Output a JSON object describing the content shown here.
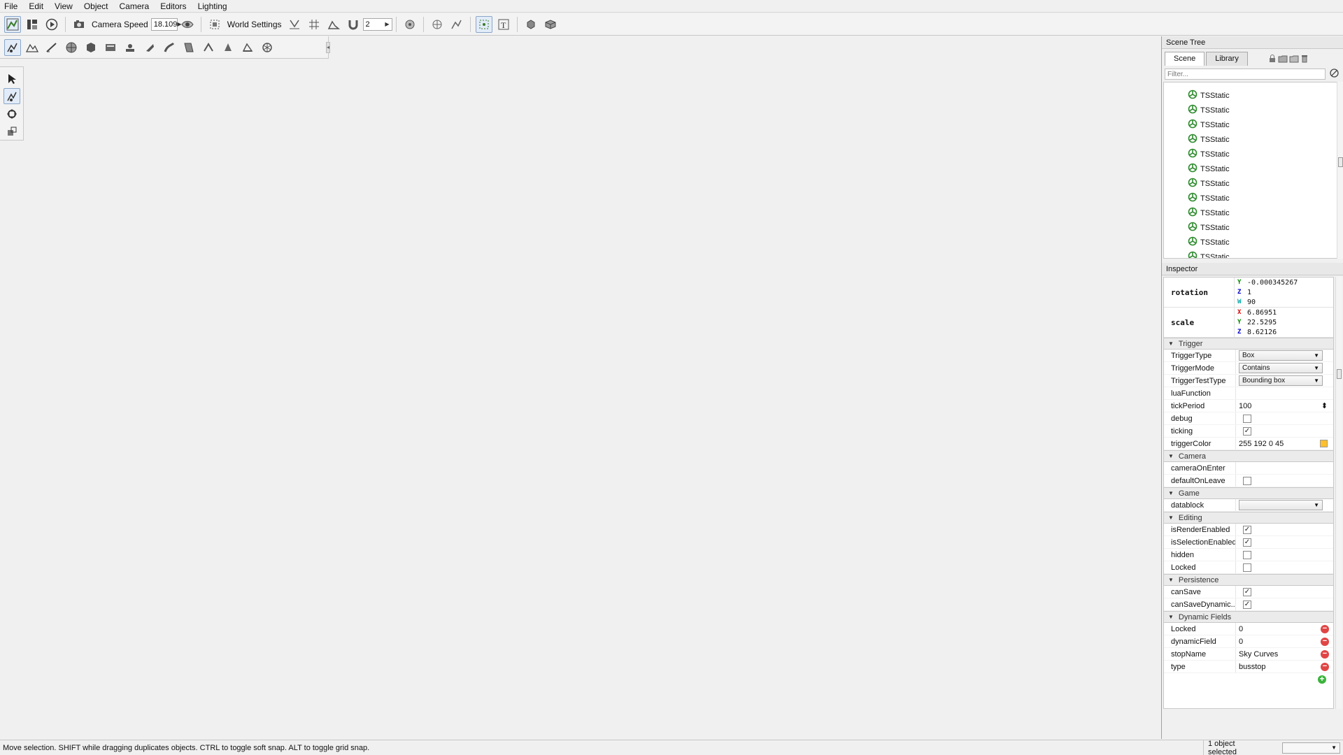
{
  "menu": [
    "File",
    "Edit",
    "View",
    "Object",
    "Camera",
    "Editors",
    "Lighting"
  ],
  "toolbar": {
    "camera_speed_label": "Camera Speed",
    "camera_speed_value": "18.109",
    "world_settings_label": "World Settings",
    "grid_value": "2"
  },
  "scene_tree": {
    "title": "Scene Tree",
    "tabs": [
      "Scene",
      "Library"
    ],
    "filter_placeholder": "Filter...",
    "items": [
      "TSStatic",
      "TSStatic",
      "TSStatic",
      "TSStatic",
      "TSStatic",
      "TSStatic",
      "TSStatic",
      "TSStatic",
      "TSStatic",
      "TSStatic",
      "TSStatic",
      "TSStatic"
    ]
  },
  "inspector": {
    "title": "Inspector",
    "rotation": {
      "label": "rotation",
      "values": [
        [
          "Y",
          "-0.000345267"
        ],
        [
          "Z",
          "1"
        ],
        [
          "W",
          "90"
        ]
      ]
    },
    "scale": {
      "label": "scale",
      "values": [
        [
          "X",
          "6.86951"
        ],
        [
          "Y",
          "22.5295"
        ],
        [
          "Z",
          "8.62126"
        ]
      ]
    },
    "trigger": {
      "header": "Trigger",
      "trigger_type": {
        "label": "TriggerType",
        "value": "Box"
      },
      "trigger_mode": {
        "label": "TriggerMode",
        "value": "Contains"
      },
      "trigger_test_type": {
        "label": "TriggerTestType",
        "value": "Bounding box"
      },
      "lua_function": {
        "label": "luaFunction",
        "value": ""
      },
      "tick_period": {
        "label": "tickPeriod",
        "value": "100"
      },
      "debug": {
        "label": "debug",
        "checked": false
      },
      "ticking": {
        "label": "ticking",
        "checked": true
      },
      "trigger_color": {
        "label": "triggerColor",
        "value": "255 192 0 45",
        "swatch": "#ffc02d"
      }
    },
    "camera": {
      "header": "Camera",
      "camera_on_enter": {
        "label": "cameraOnEnter"
      },
      "default_on_leave": {
        "label": "defaultOnLeave",
        "checked": false
      }
    },
    "game": {
      "header": "Game",
      "datablock": {
        "label": "datablock",
        "value": ""
      }
    },
    "editing": {
      "header": "Editing",
      "is_render_enabled": {
        "label": "isRenderEnabled",
        "checked": true
      },
      "is_selection_enabled": {
        "label": "isSelectionEnabled",
        "checked": true
      },
      "hidden": {
        "label": "hidden",
        "checked": false
      },
      "locked": {
        "label": "Locked",
        "checked": false
      }
    },
    "persistence": {
      "header": "Persistence",
      "can_save": {
        "label": "canSave",
        "checked": true
      },
      "can_save_dynamic": {
        "label": "canSaveDynamic...",
        "checked": true
      }
    },
    "dynamic_fields": {
      "header": "Dynamic Fields",
      "rows": [
        {
          "label": "Locked",
          "value": "0"
        },
        {
          "label": "dynamicField",
          "value": "0"
        },
        {
          "label": "stopName",
          "value": "Sky Curves"
        },
        {
          "label": "type",
          "value": "busstop"
        }
      ]
    }
  },
  "status": {
    "message": "Move selection.  SHIFT while dragging duplicates objects.  CTRL to toggle soft snap.  ALT to toggle grid snap.",
    "selection": "1 object selected"
  },
  "colors": {
    "selection_box": "#e8c56a",
    "sky_top": "#4f8fd6",
    "ground": "#d8d0c0"
  }
}
